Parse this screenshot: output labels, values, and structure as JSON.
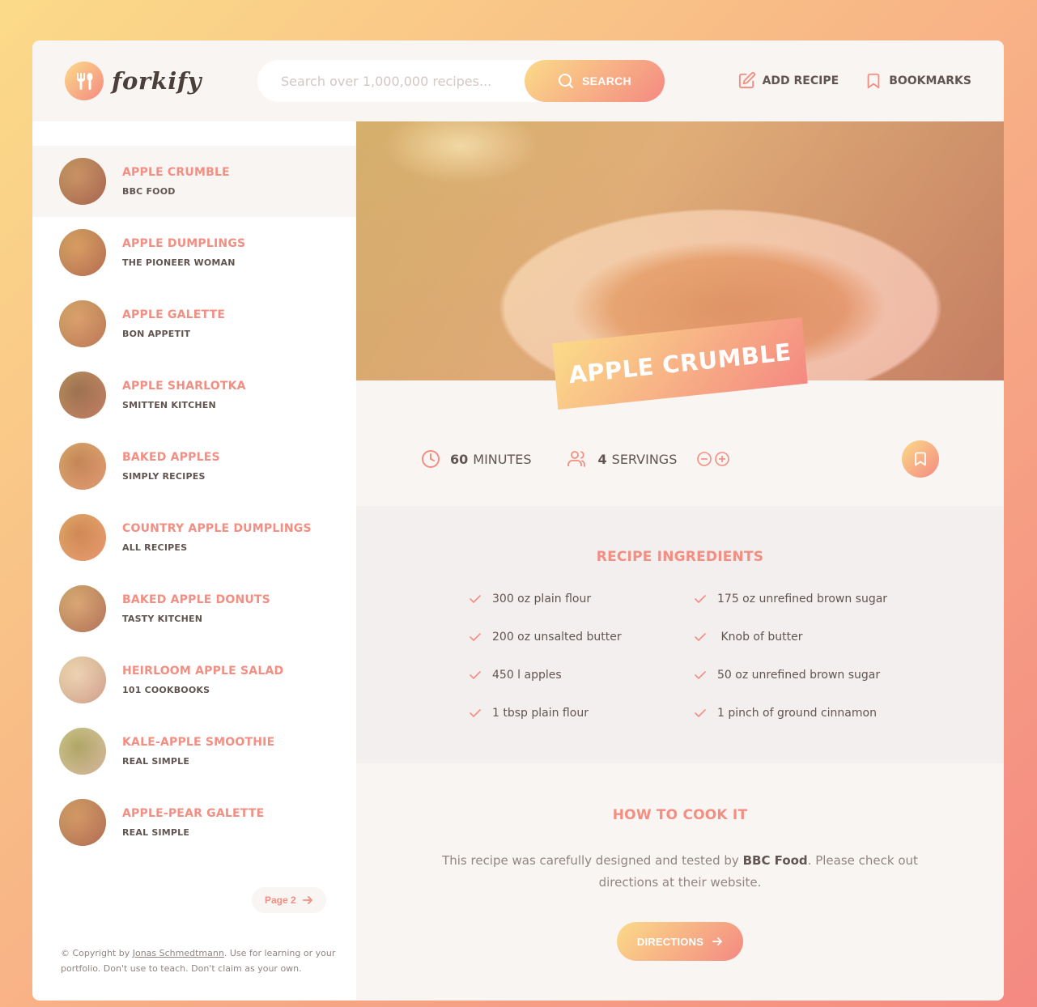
{
  "colors": {
    "accent": "#f38e82",
    "gradient_start": "#fbdb89",
    "gradient_end": "#f48982",
    "text": "#615551"
  },
  "header": {
    "logo_text": "forkify",
    "search": {
      "placeholder": "Search over 1,000,000 recipes...",
      "value": "",
      "button_label": "SEARCH"
    },
    "nav": {
      "add_recipe": "ADD RECIPE",
      "bookmarks": "BOOKMARKS"
    }
  },
  "sidebar": {
    "results": [
      {
        "title": "APPLE CRUMBLE",
        "publisher": "BBC FOOD",
        "active": true
      },
      {
        "title": "APPLE DUMPLINGS",
        "publisher": "THE PIONEER WOMAN"
      },
      {
        "title": "APPLE GALETTE",
        "publisher": "BON APPETIT"
      },
      {
        "title": "APPLE SHARLOTKA",
        "publisher": "SMITTEN KITCHEN"
      },
      {
        "title": "BAKED APPLES",
        "publisher": "SIMPLY RECIPES"
      },
      {
        "title": "COUNTRY APPLE DUMPLINGS",
        "publisher": "ALL RECIPES"
      },
      {
        "title": "BAKED APPLE DONUTS",
        "publisher": "TASTY KITCHEN"
      },
      {
        "title": "HEIRLOOM APPLE SALAD",
        "publisher": "101 COOKBOOKS"
      },
      {
        "title": "KALE-APPLE SMOOTHIE",
        "publisher": "REAL SIMPLE"
      },
      {
        "title": "APPLE-PEAR GALETTE",
        "publisher": "REAL SIMPLE"
      }
    ],
    "pagination_label": "Page 2",
    "copyright": {
      "prefix": "© Copyright by ",
      "author": "Jonas Schmedtmann",
      "suffix": ". Use for learning or your portfolio. Don't use to teach. Don't claim as your own."
    }
  },
  "recipe": {
    "title": "APPLE CRUMBLE",
    "cooking_time": "60",
    "cooking_time_unit": "MINUTES",
    "servings": "4",
    "servings_unit": "SERVINGS",
    "ingredients_heading": "RECIPE INGREDIENTS",
    "ingredients": [
      "300 oz plain flour",
      "175 oz unrefined brown sugar",
      "200 oz unsalted butter",
      " Knob of butter",
      "450 l apples",
      "50 oz unrefined brown sugar",
      "1 tbsp plain flour",
      "1 pinch of ground cinnamon"
    ],
    "directions_heading": "HOW TO COOK IT",
    "directions_text_prefix": "This recipe was carefully designed and tested by ",
    "directions_publisher": "BBC Food",
    "directions_text_suffix": ". Please check out directions at their website.",
    "directions_button": "DIRECTIONS"
  }
}
